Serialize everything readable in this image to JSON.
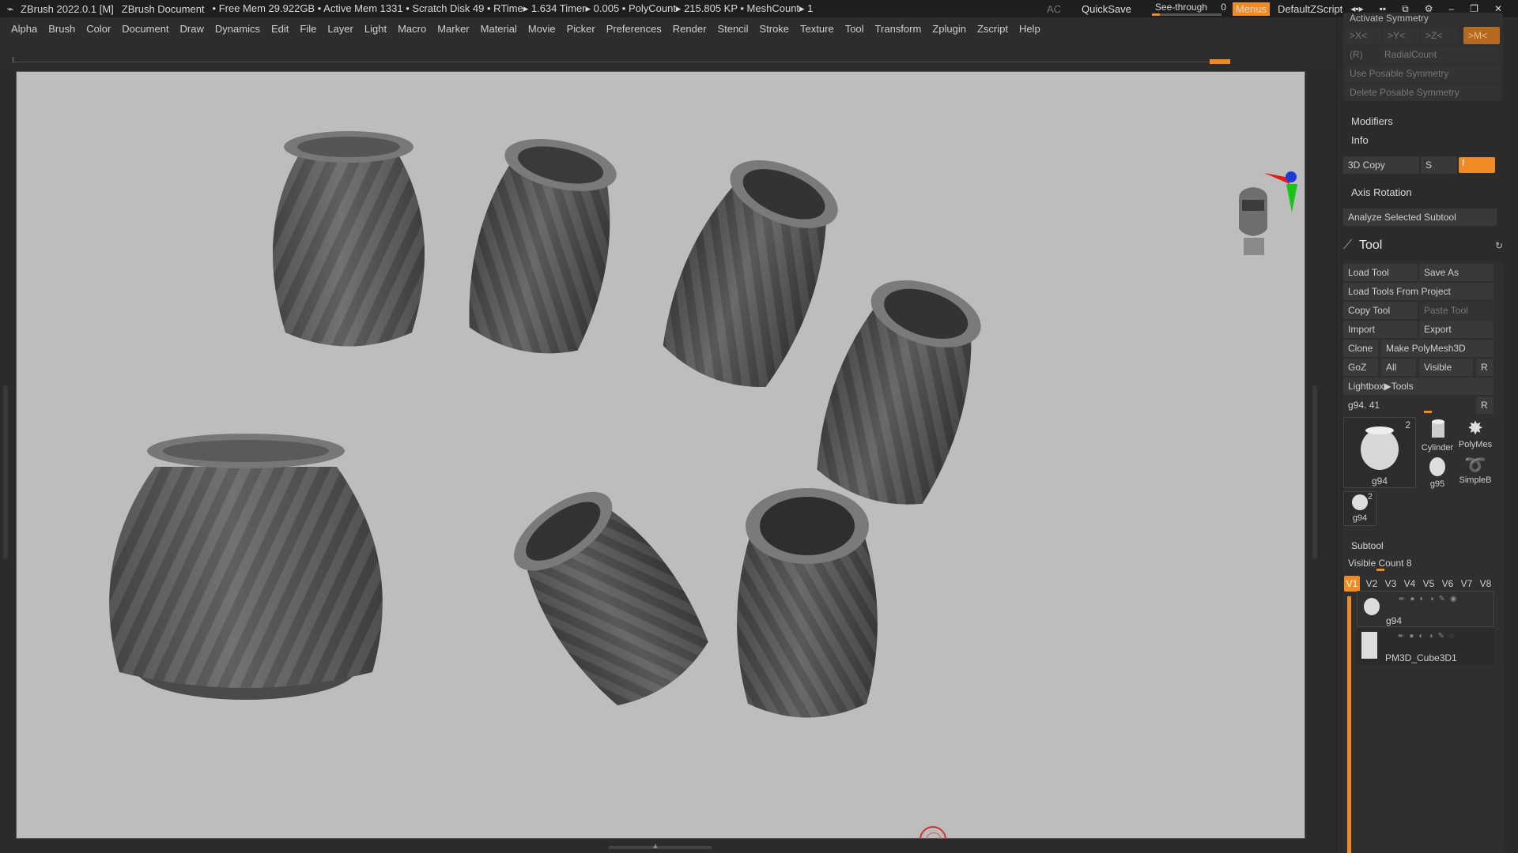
{
  "titlebar": {
    "app": "ZBrush 2022.0.1 [M]",
    "document": "ZBrush Document",
    "stats": "• Free Mem 29.922GB • Active Mem 1331 • Scratch Disk 49 •  RTime▸ 1.634 Timer▸ 0.005 • PolyCount▸ 215.805 KP  • MeshCount▸ 1",
    "ac": "AC",
    "quicksave": "QuickSave",
    "see_through_label": "See-through",
    "see_through_value": "0",
    "menus": "Menus",
    "default_zscript": "DefaultZScript"
  },
  "menubar": [
    "Alpha",
    "Brush",
    "Color",
    "Document",
    "Draw",
    "Dynamics",
    "Edit",
    "File",
    "Layer",
    "Light",
    "Macro",
    "Marker",
    "Material",
    "Movie",
    "Picker",
    "Preferences",
    "Render",
    "Stencil",
    "Stroke",
    "Texture",
    "Tool",
    "Transform",
    "Zplugin",
    "Zscript",
    "Help"
  ],
  "panel": {
    "activate_symmetry": "Activate Symmetry",
    "x_btn": ">X<",
    "y_btn": ">Y<",
    "z_btn": ">Z<",
    "m_btn": ">M<",
    "r_btn": "(R)",
    "radial_count": "RadialCount",
    "use_posable": "Use Posable Symmetry",
    "delete_posable": "Delete Posable Symmetry",
    "modifiers": "Modifiers",
    "info": "Info",
    "copy3d": "3D Copy",
    "s_label": "S",
    "i_label": "I",
    "axis_rotation": "Axis Rotation",
    "analyze": "Analyze Selected Subtool",
    "tool": {
      "title": "Tool",
      "load_tool": "Load Tool",
      "save_as": "Save As",
      "load_from_project": "Load Tools From Project",
      "copy_tool": "Copy Tool",
      "paste_tool": "Paste Tool",
      "import": "Import",
      "export": "Export",
      "clone": "Clone",
      "make_polymesh": "Make PolyMesh3D",
      "goz": "GoZ",
      "all": "All",
      "visible": "Visible",
      "r": "R",
      "lightbox_tools": "Lightbox▶Tools",
      "current_tool": "g94. 41",
      "thumb_main_label": "g94",
      "thumb_main_count": "2",
      "thumb_cylinder": "Cylinder",
      "thumb_polymesh": "PolyMes",
      "thumb_g95": "g95",
      "thumb_simpleb": "SimpleB",
      "thumb_small_label": "g94",
      "thumb_small_count": "2"
    },
    "subtool": {
      "title": "Subtool",
      "visible_count": "Visible Count 8",
      "tabs": [
        "V1",
        "V2",
        "V3",
        "V4",
        "V5",
        "V6",
        "V7",
        "V8"
      ],
      "items": [
        "g94",
        "PM3D_Cube3D1"
      ]
    }
  }
}
